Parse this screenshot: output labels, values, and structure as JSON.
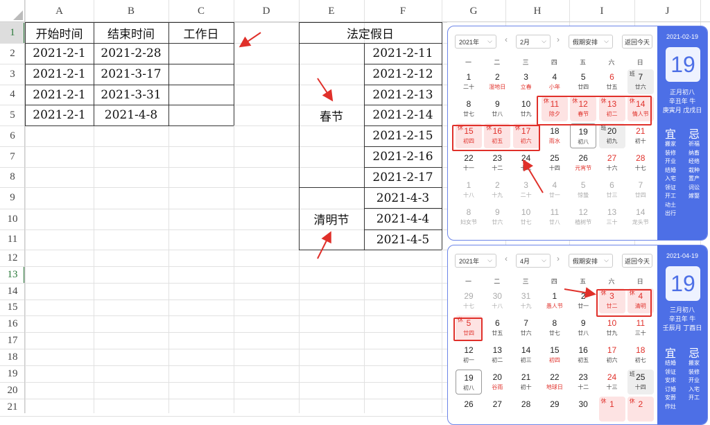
{
  "columns": [
    "A",
    "B",
    "C",
    "D",
    "E",
    "F",
    "G",
    "H",
    "I",
    "J"
  ],
  "rows": [
    "1",
    "2",
    "3",
    "4",
    "5",
    "6",
    "7",
    "8",
    "9",
    "10",
    "11",
    "12",
    "13",
    "14",
    "15",
    "16",
    "17",
    "18",
    "19",
    "20",
    "21"
  ],
  "table": {
    "headers": [
      "开始时间",
      "结束时间",
      "工作日"
    ],
    "start": [
      "2021-2-1",
      "2021-2-1",
      "2021-2-1",
      "2021-2-1"
    ],
    "end": [
      "2021-2-28",
      "2021-3-17",
      "2021-3-31",
      "2021-4-8"
    ]
  },
  "holidays": {
    "header": "法定假日",
    "spring_label": "春节",
    "spring_dates": [
      "2021-2-11",
      "2021-2-12",
      "2021-2-13",
      "2021-2-14",
      "2021-2-15",
      "2021-2-16",
      "2021-2-17"
    ],
    "qingming_label": "清明节",
    "qingming_dates": [
      "2021-4-3",
      "2021-4-4",
      "2021-4-5"
    ]
  },
  "weekdays": [
    "一",
    "二",
    "三",
    "四",
    "五",
    "六",
    "日"
  ],
  "cal1": {
    "year": "2021年",
    "month": "2月",
    "holiday_select": "假期安排",
    "today_btn": "返回今天",
    "side_date": "2021-02-19",
    "side_day": "19",
    "side_lunar": "正月初八",
    "side_year": "辛丑年 牛",
    "side_gz": "庚寅月 戊戌日",
    "yi_label": "宜",
    "ji_label": "忌",
    "yi": [
      "搬家",
      "装修",
      "开业",
      "结婚",
      "入宅",
      "领证",
      "开工",
      "动土",
      "出行"
    ],
    "ji": [
      "祈福",
      "纳畜",
      "经络",
      "栽种",
      "置产",
      "词讼",
      "嫁娶"
    ]
  },
  "cal2": {
    "year": "2021年",
    "month": "4月",
    "holiday_select": "假期安排",
    "today_btn": "返回今天",
    "side_date": "2021-04-19",
    "side_day": "19",
    "side_lunar": "三月初八",
    "side_year": "辛丑年 牛",
    "side_gz": "壬辰月 丁酉日",
    "yi_label": "宜",
    "ji_label": "忌",
    "yi": [
      "结婚",
      "领证",
      "安床",
      "订婚",
      "安葬",
      "作灶"
    ],
    "ji": [
      "搬家",
      "装修",
      "开业",
      "入宅",
      "开工"
    ]
  },
  "cal1_days": [
    [
      "1",
      "二十",
      ""
    ],
    [
      "2",
      "湿地日",
      "reds"
    ],
    [
      "3",
      "立春",
      "reds"
    ],
    [
      "4",
      "小年",
      "reds"
    ],
    [
      "5",
      "廿四",
      ""
    ],
    [
      "6",
      "廿五",
      "red"
    ],
    [
      "7",
      "廿六",
      "work"
    ],
    [
      "8",
      "廿七",
      ""
    ],
    [
      "9",
      "廿八",
      ""
    ],
    [
      "10",
      "廿九",
      ""
    ],
    [
      "11",
      "除夕",
      "hol"
    ],
    [
      "12",
      "春节",
      "hol"
    ],
    [
      "13",
      "初二",
      "hol"
    ],
    [
      "14",
      "情人节",
      "hol"
    ],
    [
      "15",
      "初四",
      "hol"
    ],
    [
      "16",
      "初五",
      "hol"
    ],
    [
      "17",
      "初六",
      "hol"
    ],
    [
      "18",
      "雨水",
      "reds"
    ],
    [
      "19",
      "初八",
      "today"
    ],
    [
      "20",
      "初九",
      "work"
    ],
    [
      "21",
      "初十",
      "red"
    ],
    [
      "22",
      "十一",
      ""
    ],
    [
      "23",
      "十二",
      ""
    ],
    [
      "24",
      "十三",
      ""
    ],
    [
      "25",
      "十四",
      ""
    ],
    [
      "26",
      "元宵节",
      "reds"
    ],
    [
      "27",
      "十六",
      "red"
    ],
    [
      "28",
      "十七",
      "red"
    ],
    [
      "1",
      "十八",
      "dim"
    ],
    [
      "2",
      "十九",
      "dim"
    ],
    [
      "3",
      "二十",
      "dim"
    ],
    [
      "4",
      "廿一",
      "dim"
    ],
    [
      "5",
      "惊蛰",
      "dim"
    ],
    [
      "6",
      "廿三",
      "dim"
    ],
    [
      "7",
      "廿四",
      "dim"
    ],
    [
      "8",
      "妇女节",
      "dim"
    ],
    [
      "9",
      "廿六",
      "dim"
    ],
    [
      "10",
      "廿七",
      "dim"
    ],
    [
      "11",
      "廿八",
      "dim"
    ],
    [
      "12",
      "植树节",
      "dim"
    ],
    [
      "13",
      "三十",
      "dim"
    ],
    [
      "14",
      "龙头节",
      "dim"
    ]
  ],
  "cal2_days": [
    [
      "29",
      "十七",
      "dim"
    ],
    [
      "30",
      "十八",
      "dim"
    ],
    [
      "31",
      "十九",
      "dim"
    ],
    [
      "1",
      "愚人节",
      "reds"
    ],
    [
      "2",
      "廿一",
      ""
    ],
    [
      "3",
      "廿二",
      "hol"
    ],
    [
      "4",
      "清明",
      "hol"
    ],
    [
      "5",
      "廿四",
      "hol"
    ],
    [
      "6",
      "廿五",
      ""
    ],
    [
      "7",
      "廿六",
      ""
    ],
    [
      "8",
      "廿七",
      ""
    ],
    [
      "9",
      "廿八",
      ""
    ],
    [
      "10",
      "廿九",
      "red"
    ],
    [
      "11",
      "三十",
      "red"
    ],
    [
      "12",
      "初一",
      ""
    ],
    [
      "13",
      "初二",
      ""
    ],
    [
      "14",
      "初三",
      ""
    ],
    [
      "15",
      "初四",
      "reds"
    ],
    [
      "16",
      "初五",
      ""
    ],
    [
      "17",
      "初六",
      "red"
    ],
    [
      "18",
      "初七",
      "red"
    ],
    [
      "19",
      "初八",
      "today"
    ],
    [
      "20",
      "谷雨",
      "reds"
    ],
    [
      "21",
      "初十",
      ""
    ],
    [
      "22",
      "地球日",
      "reds"
    ],
    [
      "23",
      "十二",
      ""
    ],
    [
      "24",
      "十三",
      "red"
    ],
    [
      "25",
      "十四",
      "work"
    ],
    [
      "26",
      "",
      ""
    ],
    [
      "27",
      "",
      ""
    ],
    [
      "28",
      "",
      ""
    ],
    [
      "29",
      "",
      ""
    ],
    [
      "30",
      "",
      ""
    ],
    [
      "1",
      "",
      "hol"
    ],
    [
      "2",
      "",
      "hol"
    ]
  ],
  "tags": {
    "rest": "休",
    "work": "班"
  }
}
